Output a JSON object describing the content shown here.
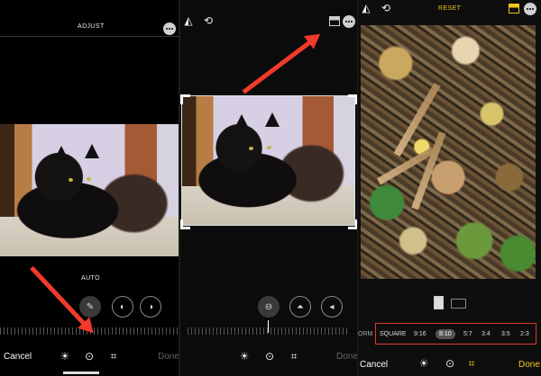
{
  "panel1": {
    "header": "ADJUST",
    "mode_label": "AUTO",
    "cancel_label": "Cancel",
    "done_label": "Done"
  },
  "panel2": {
    "done_label": "Done"
  },
  "panel3": {
    "reset_label": "RESET",
    "cancel_label": "Cancel",
    "done_label": "Done",
    "ratio_partial": "ORM",
    "ratios": [
      "SQUARE",
      "9:16",
      "8:10",
      "5:7",
      "3:4",
      "3:5",
      "2:3"
    ],
    "selected_ratio": "8:10"
  },
  "colors": {
    "accent_yellow": "#f5c518",
    "arrow_red": "#f03a2a",
    "highlight_box": "#e03a2a"
  },
  "icons": [
    "more-icon",
    "magic-wand-icon",
    "exposure-icon",
    "contrast-icon",
    "sun-icon",
    "filters-icon",
    "crop-icon",
    "flip-icon",
    "rotate-icon",
    "aspect-ratio-icon",
    "straighten-icon",
    "vertical-perspective-icon",
    "horizontal-perspective-icon",
    "portrait-orientation-icon",
    "landscape-orientation-icon"
  ]
}
